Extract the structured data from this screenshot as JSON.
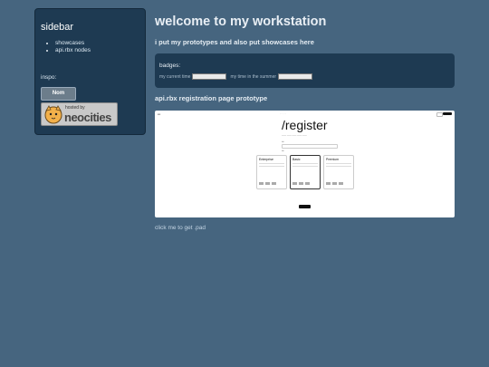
{
  "sidebar": {
    "title": "sidebar",
    "links": [
      "showcases",
      "api.rbx nodes"
    ],
    "inspo_label": "inspo:",
    "badge_nom_text": "Nom",
    "badge_neocities_hosted": "hosted by",
    "badge_neocities_brand": "neocities"
  },
  "main": {
    "title": "welcome to my workstation",
    "subtitle": "i put my prototypes and also put showcases here",
    "badges_label": "badges:",
    "badge_current_time": "my current time",
    "badge_summer_time": "my time in the summer",
    "prototype_title": "api.rbx registration page prototype",
    "pad_link": "click me to get .pad"
  },
  "prototype_screenshot": {
    "page_heading": "/register",
    "plans": [
      "Enterprise",
      "Basic",
      "Premium"
    ]
  },
  "colors": {
    "background": "#46657f",
    "panel": "#1e3a52"
  }
}
